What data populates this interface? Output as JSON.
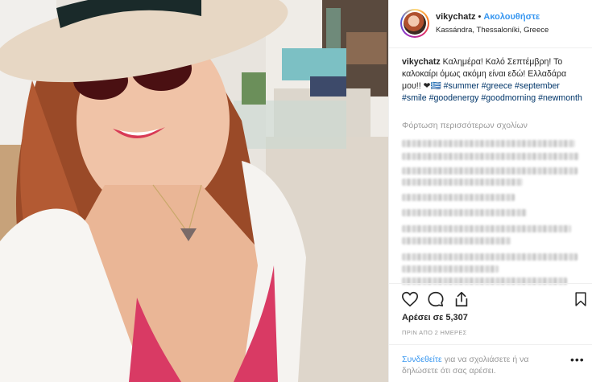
{
  "post": {
    "username": "vikychatz",
    "separator": "•",
    "follow_label": "Ακολουθήστε",
    "location": "Kassándra, Thessaloníki, Greece",
    "caption_user": "vikychatz",
    "caption_text": "Καλημέρα! Καλό Σεπτέμβρη! Το καλοκαίρι όμως ακόμη είναι εδώ! Ελλαδάρα μου!! ❤🇬🇷",
    "hashtags": [
      "#summer",
      "#greece",
      "#september",
      "#smile",
      "#goodenergy",
      "#goodmorning",
      "#newmonth"
    ],
    "load_more_comments": "Φόρτωση περισσότερων σχολίων",
    "likes": "Αρέσει σε 5,307",
    "timestamp": "ΠΡΙΝ ΑΠΟ 2 ΗΜΕΡΕΣ",
    "login_link": "Συνδεθείτε",
    "login_rest": " για να σχολιάσετε ή να δηλώσετε ότι σας αρέσει.",
    "more_options": "•••"
  },
  "icons": {
    "like": "heart-icon",
    "comment": "comment-bubble-icon",
    "share": "share-icon",
    "save": "bookmark-icon"
  },
  "colors": {
    "link_blue": "#3897f0",
    "hashtag": "#003569",
    "muted": "#999999",
    "text": "#262626"
  }
}
